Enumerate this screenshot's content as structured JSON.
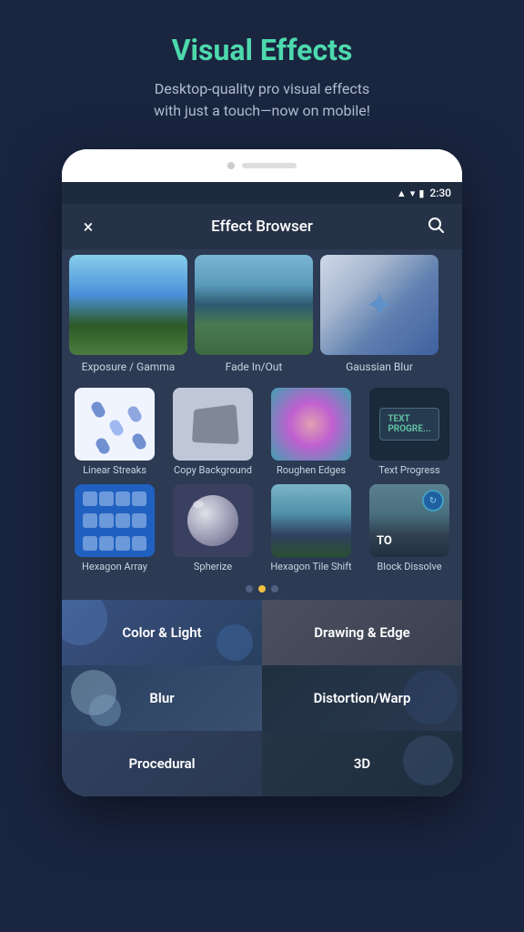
{
  "header": {
    "title": "Visual Effects",
    "subtitle": "Desktop-quality pro visual effects\nwith just a touch—now on mobile!"
  },
  "statusBar": {
    "time": "2:30",
    "signalIcon": "signal-icon",
    "wifiIcon": "wifi-icon",
    "batteryIcon": "battery-icon"
  },
  "navBar": {
    "title": "Effect Browser",
    "closeIcon": "×",
    "searchIcon": "🔍"
  },
  "featuredEffects": [
    {
      "label": "Exposure / Gamma",
      "type": "sky"
    },
    {
      "label": "Fade In/Out",
      "type": "lake"
    },
    {
      "label": "Gaussian Blur",
      "type": "blur"
    }
  ],
  "gridEffects": [
    {
      "label": "Linear Streaks",
      "type": "streaks"
    },
    {
      "label": "Copy Background",
      "type": "copy-bg"
    },
    {
      "label": "Roughen Edges",
      "type": "roughen"
    },
    {
      "label": "Text Progress",
      "type": "text-progress"
    },
    {
      "label": "Hexagon Array",
      "type": "hex-array"
    },
    {
      "label": "Spherize",
      "type": "spherize"
    },
    {
      "label": "Hexagon Tile Shift",
      "type": "hex-tile"
    },
    {
      "label": "Block Dissolve",
      "type": "block-dissolve"
    }
  ],
  "pagination": {
    "dots": [
      {
        "active": false
      },
      {
        "active": true
      },
      {
        "active": false
      }
    ]
  },
  "categories": [
    {
      "label": "Color & Light",
      "style": "cat-color-light"
    },
    {
      "label": "Drawing & Edge",
      "style": "cat-color-drawing"
    },
    {
      "label": "Blur",
      "style": "cat-color-blur"
    },
    {
      "label": "Distortion/Warp",
      "style": "cat-color-distortion"
    },
    {
      "label": "Procedural",
      "style": "cat-color-procedural"
    },
    {
      "label": "3D",
      "style": "cat-color-3d"
    }
  ]
}
